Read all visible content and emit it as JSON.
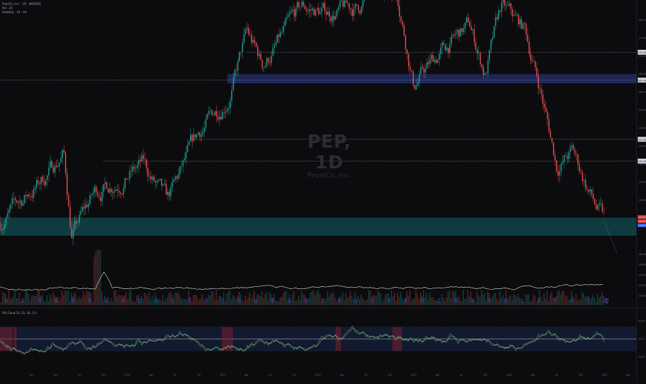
{
  "legend": {
    "symbol_line": "PepsiCo, Inc. · 1D · NASDAQ",
    "volume_line": "Vol · 20",
    "indicator_line": "Volatility · 40 · Atr"
  },
  "watermark": {
    "symbol": "PEP, 1D",
    "name": "PepsiCo, Inc."
  },
  "oscillator_legend": "RSI Cloud 14, 21, 30, 2.0",
  "colors": {
    "background": "#0c0c0e",
    "up_candle": "#26a69a",
    "down_candle": "#ef5350",
    "blue_zone": "#2b3d8f",
    "teal_zone": "#13636a",
    "osc_green": "#4caf50",
    "osc_line_light": "#dde6c8",
    "osc_band": "#141e3a",
    "price_label_red": "#e53935",
    "price_label_blue": "#2962ff"
  },
  "chart_data": [
    {
      "type": "candlestick",
      "symbol": "PEP",
      "interval": "1D",
      "x_range": [
        "2019-06",
        "2026-02"
      ],
      "y_range": [
        125,
        182
      ],
      "x_ticks": [
        "Jan",
        "Apr",
        "Jul",
        "Oct",
        "2020",
        "Apr",
        "Jul",
        "Oct",
        "2021",
        "Apr",
        "Jul",
        "Oct",
        "2022",
        "Apr",
        "Jul",
        "Oct",
        "2023",
        "Apr",
        "Jul",
        "Oct",
        "2024",
        "Apr",
        "Jul",
        "Oct",
        "2025",
        "Apr",
        "Jul",
        "Oct"
      ],
      "y_ticks": [
        "180.00",
        "175.00",
        "170.00",
        "165.00",
        "160.00",
        "155.00",
        "150.00",
        "145.00",
        "140.00",
        "135.00",
        "130.00",
        "125.00"
      ],
      "close_path": [
        {
          "x": "2019-06",
          "y": 131
        },
        {
          "x": "2019-11",
          "y": 140
        },
        {
          "x": "2020-02",
          "y": 147
        },
        {
          "x": "2020-03",
          "y": 128
        },
        {
          "x": "2020-06",
          "y": 138
        },
        {
          "x": "2020-09",
          "y": 141
        },
        {
          "x": "2020-12",
          "y": 144
        },
        {
          "x": "2021-03",
          "y": 135
        },
        {
          "x": "2021-07",
          "y": 151
        },
        {
          "x": "2021-11",
          "y": 161
        },
        {
          "x": "2022-01",
          "y": 174
        },
        {
          "x": "2022-03",
          "y": 167
        },
        {
          "x": "2022-05",
          "y": 172
        },
        {
          "x": "2022-08",
          "y": 180
        },
        {
          "x": "2022-11",
          "y": 179
        },
        {
          "x": "2023-03",
          "y": 180
        },
        {
          "x": "2023-05",
          "y": 186
        },
        {
          "x": "2023-08",
          "y": 184
        },
        {
          "x": "2023-10",
          "y": 163
        },
        {
          "x": "2024-01",
          "y": 169
        },
        {
          "x": "2024-05",
          "y": 176
        },
        {
          "x": "2024-07",
          "y": 165
        },
        {
          "x": "2024-09",
          "y": 180
        },
        {
          "x": "2024-12",
          "y": 175
        },
        {
          "x": "2025-02",
          "y": 161
        },
        {
          "x": "2025-04",
          "y": 144
        },
        {
          "x": "2025-06",
          "y": 147
        },
        {
          "x": "2025-09",
          "y": 134
        },
        {
          "x": "2025-10",
          "y": 131
        }
      ],
      "horizontal_levels": [
        {
          "price_label": "170.00"
        },
        {
          "price_label": "160.00"
        },
        {
          "price_label": "150.00"
        },
        {
          "price_label": "145.00"
        }
      ],
      "zones": [
        {
          "name": "supply",
          "from": 163,
          "to": 165,
          "color": "blue"
        },
        {
          "name": "demand",
          "from": 128,
          "to": 132,
          "color": "teal"
        }
      ],
      "price_labels": [
        "132.00",
        "131.00",
        "130.00"
      ],
      "volume_panel": true,
      "grid": false
    },
    {
      "type": "line",
      "name": "oscillator",
      "y_ticks": [
        "80.00",
        "50.00",
        "20.00"
      ],
      "band": [
        30,
        70
      ],
      "series_names": []
    }
  ]
}
